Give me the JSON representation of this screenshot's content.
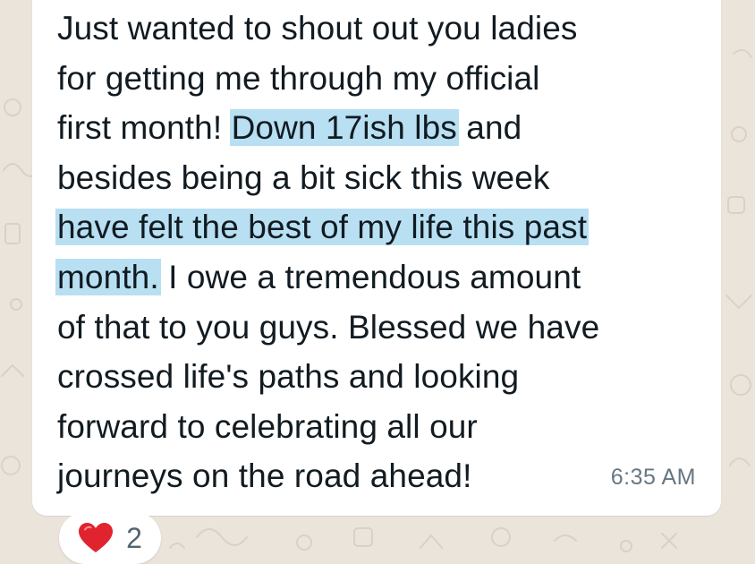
{
  "message": {
    "segments": [
      [
        {
          "text": "Just wanted to shout out you ladies"
        }
      ],
      [
        {
          "text": "for getting me through my official"
        }
      ],
      [
        {
          "text": "first month! "
        },
        {
          "text": "Down 17ish lbs",
          "highlighted": true
        },
        {
          "text": " and"
        }
      ],
      [
        {
          "text": "besides being a bit sick this week"
        }
      ],
      [
        {
          "text": "have felt the best of my life this past",
          "highlighted": true
        }
      ],
      [
        {
          "text": "month.",
          "highlighted": true
        },
        {
          "text": " I owe a tremendous amount"
        }
      ],
      [
        {
          "text": "of that to you guys. Blessed we have"
        }
      ],
      [
        {
          "text": "crossed life's paths and looking"
        }
      ],
      [
        {
          "text": "forward to celebrating all our"
        }
      ],
      [
        {
          "text": "journeys on the road ahead!"
        }
      ]
    ],
    "timestamp": "6:35 AM"
  },
  "reaction": {
    "icon": "red-heart-icon",
    "count": "2"
  },
  "colors": {
    "wallpaper": "#ebe4da",
    "bubble": "#ffffff",
    "highlight": "#b8dff2",
    "text": "#111b21",
    "timestamp": "#667781",
    "heart": "#e0242f"
  }
}
